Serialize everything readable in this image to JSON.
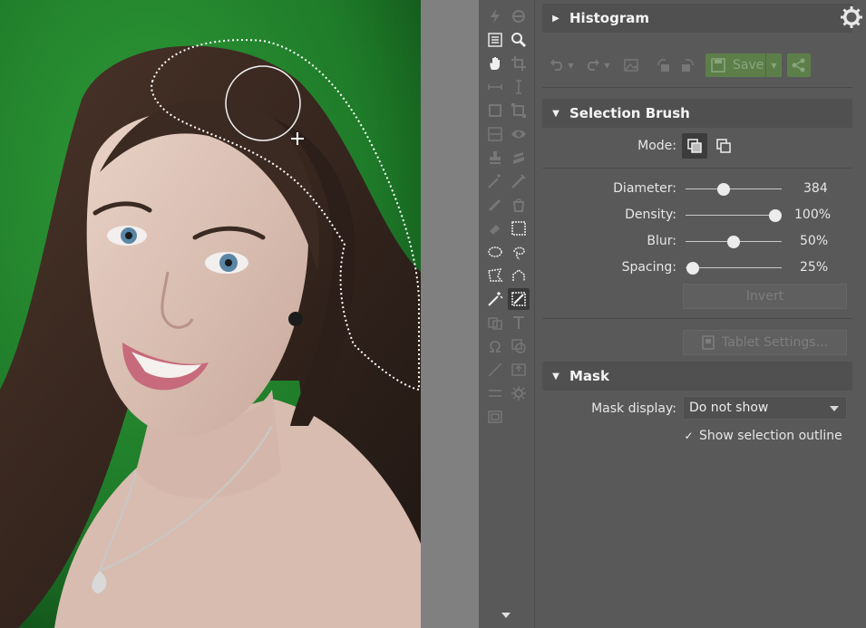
{
  "histogram": {
    "title": "Histogram"
  },
  "toolbar": {
    "save_label": "Save"
  },
  "selection_brush": {
    "title": "Selection Brush",
    "mode_label": "Mode:",
    "sliders": [
      {
        "label": "Diameter:",
        "value": "384",
        "fraction": 0.4
      },
      {
        "label": "Density:",
        "value": "100%",
        "fraction": 0.93
      },
      {
        "label": "Blur:",
        "value": "50%",
        "fraction": 0.5
      },
      {
        "label": "Spacing:",
        "value": "25%",
        "fraction": 0.08
      }
    ],
    "invert_label": "Invert",
    "tablet_settings_label": "Tablet Settings..."
  },
  "mask": {
    "title": "Mask",
    "display_label": "Mask display:",
    "display_value": "Do not show",
    "show_outline_label": "Show selection outline",
    "show_outline_checked": true
  },
  "colors": {
    "save_green": "#5c7f4a",
    "panel_bg": "#595959",
    "header_bg": "#505050",
    "active_tool_bg": "#3a3a3a"
  },
  "tool_icons": [
    "lightning-icon",
    "auto-fix-icon",
    "histogram-grid-icon",
    "zoom-icon",
    "hand-icon",
    "crop-icon",
    "horizontal-resize-icon",
    "vertical-resize-icon",
    "rectangle-tool-icon",
    "transform-icon",
    "gradient-icon",
    "eye-icon",
    "stamp-icon",
    "layer-icon",
    "wand-icon",
    "brush-icon",
    "pencil-icon",
    "bucket-icon",
    "eraser-icon",
    "rect-select-icon",
    "ellipse-select-icon",
    "lasso-icon",
    "polygon-lasso-icon",
    "magnetic-lasso-icon",
    "magic-wand-icon",
    "selection-brush-icon",
    "clone-layer-icon",
    "text-icon",
    "omega-icon",
    "shape-icon",
    "line-icon",
    "image-insert-icon",
    "align-icon",
    "settings-small-icon",
    "frame-icon"
  ]
}
